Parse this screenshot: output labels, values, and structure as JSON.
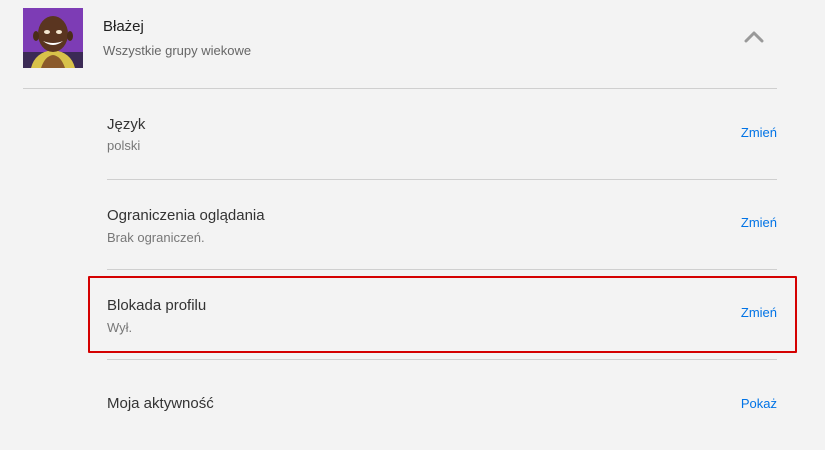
{
  "profile": {
    "name": "Błażej",
    "rating": "Wszystkie grupy wiekowe",
    "avatar_icon": "character-avatar",
    "toggle_icon": "chevron-up-icon"
  },
  "settings": [
    {
      "title": "Język",
      "value": "polski",
      "action": "Zmień"
    },
    {
      "title": "Ograniczenia oglądania",
      "value": "Brak ograniczeń.",
      "action": "Zmień"
    },
    {
      "title": "Blokada profilu",
      "value": "Wył.",
      "action": "Zmień"
    },
    {
      "title": "Moja aktywność",
      "value": "",
      "action": "Pokaż"
    }
  ],
  "colors": {
    "action": "#0073e6",
    "highlight": "#d40000",
    "background": "#f3f3f3"
  }
}
